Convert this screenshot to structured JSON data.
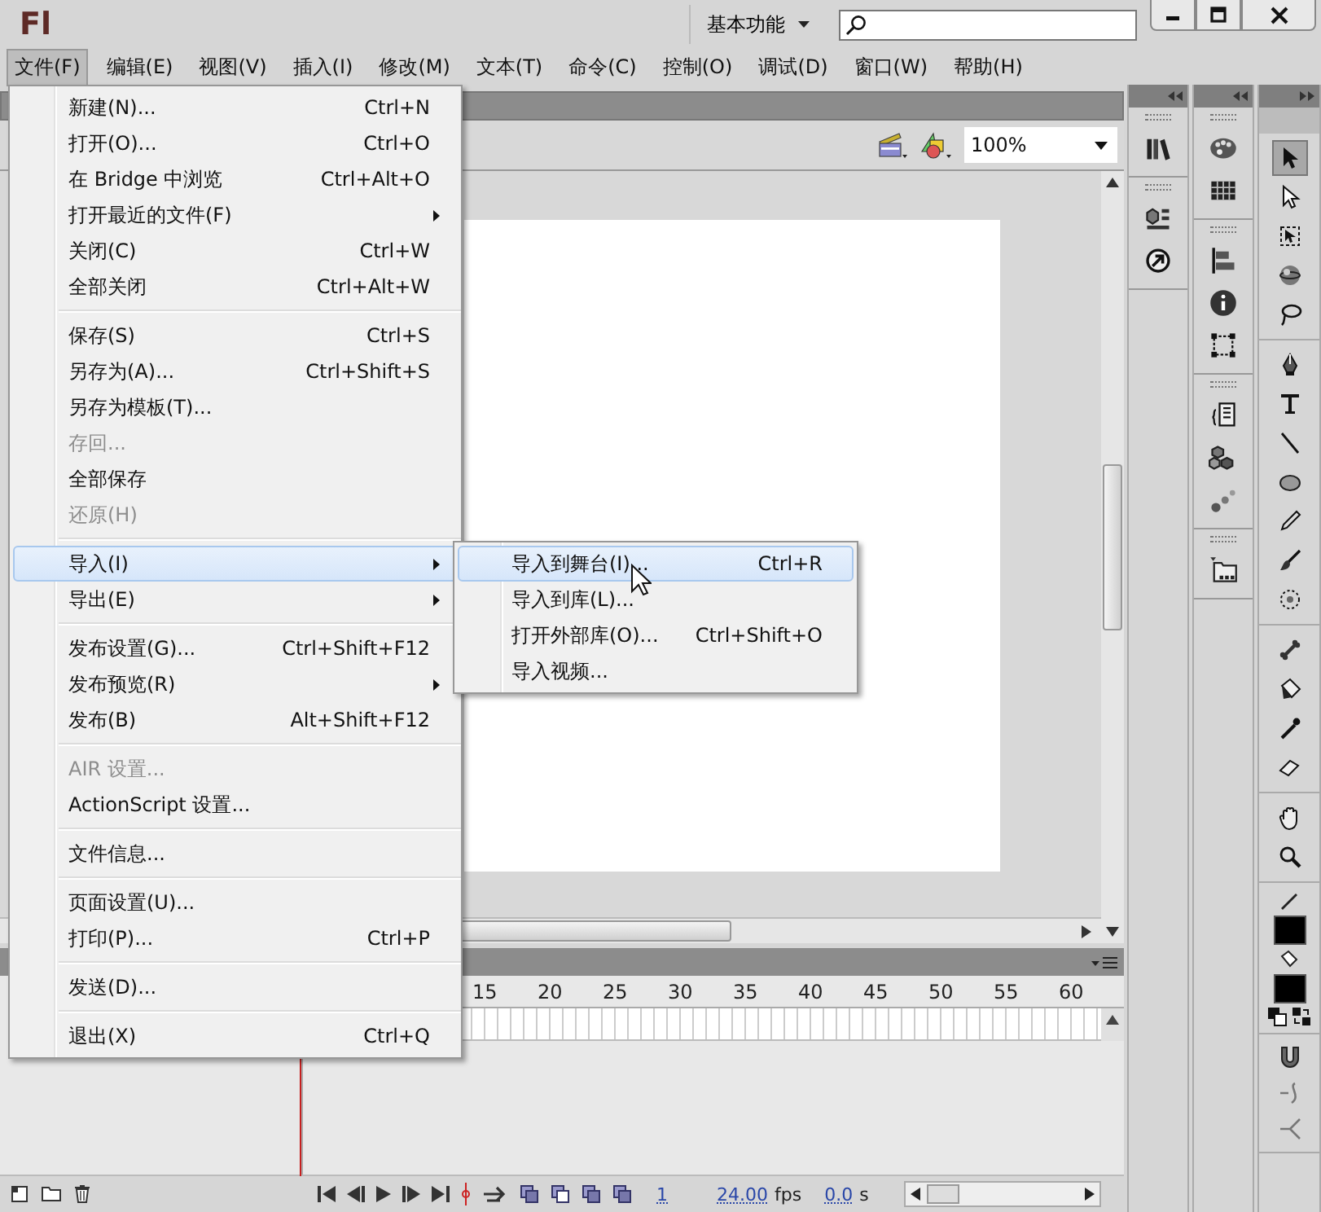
{
  "app_logo": "Fl",
  "workspace": {
    "label": "基本功能"
  },
  "menubar": [
    {
      "label": "文件(F)",
      "selected": true
    },
    {
      "label": "编辑(E)",
      "selected": false
    },
    {
      "label": "视图(V)",
      "selected": false
    },
    {
      "label": "插入(I)",
      "selected": false
    },
    {
      "label": "修改(M)",
      "selected": false
    },
    {
      "label": "文本(T)",
      "selected": false
    },
    {
      "label": "命令(C)",
      "selected": false
    },
    {
      "label": "控制(O)",
      "selected": false
    },
    {
      "label": "调试(D)",
      "selected": false
    },
    {
      "label": "窗口(W)",
      "selected": false
    },
    {
      "label": "帮助(H)",
      "selected": false
    }
  ],
  "file_menu": [
    [
      {
        "label": "新建(N)...",
        "shortcut": "Ctrl+N",
        "submenu": false,
        "disabled": false,
        "selected": false
      },
      {
        "label": "打开(O)...",
        "shortcut": "Ctrl+O",
        "submenu": false,
        "disabled": false,
        "selected": false
      },
      {
        "label": "在 Bridge 中浏览",
        "shortcut": "Ctrl+Alt+O",
        "submenu": false,
        "disabled": false,
        "selected": false
      },
      {
        "label": "打开最近的文件(F)",
        "submenu": true,
        "disabled": false,
        "selected": false
      },
      {
        "label": "关闭(C)",
        "shortcut": "Ctrl+W",
        "submenu": false,
        "disabled": false,
        "selected": false
      },
      {
        "label": "全部关闭",
        "shortcut": "Ctrl+Alt+W",
        "submenu": false,
        "disabled": false,
        "selected": false
      }
    ],
    [
      {
        "label": "保存(S)",
        "shortcut": "Ctrl+S",
        "submenu": false,
        "disabled": false,
        "selected": false
      },
      {
        "label": "另存为(A)...",
        "shortcut": "Ctrl+Shift+S",
        "submenu": false,
        "disabled": false,
        "selected": false
      },
      {
        "label": "另存为模板(T)...",
        "submenu": false,
        "disabled": false,
        "selected": false
      },
      {
        "label": "存回...",
        "submenu": false,
        "disabled": true,
        "selected": false
      },
      {
        "label": "全部保存",
        "submenu": false,
        "disabled": false,
        "selected": false
      },
      {
        "label": "还原(H)",
        "submenu": false,
        "disabled": true,
        "selected": false
      }
    ],
    [
      {
        "label": "导入(I)",
        "submenu": true,
        "disabled": false,
        "selected": true
      },
      {
        "label": "导出(E)",
        "submenu": true,
        "disabled": false,
        "selected": false
      }
    ],
    [
      {
        "label": "发布设置(G)...",
        "shortcut": "Ctrl+Shift+F12",
        "submenu": false,
        "disabled": false,
        "selected": false
      },
      {
        "label": "发布预览(R)",
        "submenu": true,
        "disabled": false,
        "selected": false
      },
      {
        "label": "发布(B)",
        "shortcut": "Alt+Shift+F12",
        "submenu": false,
        "disabled": false,
        "selected": false
      }
    ],
    [
      {
        "label": "AIR 设置...",
        "submenu": false,
        "disabled": true,
        "selected": false
      },
      {
        "label": "ActionScript 设置...",
        "submenu": false,
        "disabled": false,
        "selected": false
      }
    ],
    [
      {
        "label": "文件信息...",
        "submenu": false,
        "disabled": false,
        "selected": false
      }
    ],
    [
      {
        "label": "页面设置(U)...",
        "submenu": false,
        "disabled": false,
        "selected": false
      },
      {
        "label": "打印(P)...",
        "shortcut": "Ctrl+P",
        "submenu": false,
        "disabled": false,
        "selected": false
      }
    ],
    [
      {
        "label": "发送(D)...",
        "submenu": false,
        "disabled": false,
        "selected": false
      }
    ],
    [
      {
        "label": "退出(X)",
        "shortcut": "Ctrl+Q",
        "submenu": false,
        "disabled": false,
        "selected": false
      }
    ]
  ],
  "import_submenu": [
    {
      "label": "导入到舞台(I)...",
      "shortcut": "Ctrl+R",
      "selected": true
    },
    {
      "label": "导入到库(L)...",
      "selected": false
    },
    {
      "label": "打开外部库(O)...",
      "shortcut": "Ctrl+Shift+O",
      "selected": false
    },
    {
      "label": "导入视频...",
      "selected": false
    }
  ],
  "zoom": {
    "value": "100%"
  },
  "tools": [
    [
      {
        "kind": "selection",
        "selected": true
      },
      {
        "kind": "subselection",
        "selected": false
      },
      {
        "kind": "free-transform",
        "selected": false
      },
      {
        "kind": "rotate-3d",
        "selected": false
      },
      {
        "kind": "lasso",
        "selected": false
      }
    ],
    [
      {
        "kind": "pen",
        "selected": false
      },
      {
        "kind": "text",
        "selected": false
      },
      {
        "kind": "line",
        "selected": false
      },
      {
        "kind": "oval",
        "selected": false
      },
      {
        "kind": "pencil",
        "selected": false
      },
      {
        "kind": "brush",
        "selected": false
      },
      {
        "kind": "deco",
        "selected": false
      }
    ],
    [
      {
        "kind": "bone",
        "selected": false
      },
      {
        "kind": "bucket",
        "selected": false
      },
      {
        "kind": "eyedropper",
        "selected": false
      },
      {
        "kind": "eraser",
        "selected": false
      }
    ],
    [
      {
        "kind": "hand",
        "selected": false
      },
      {
        "kind": "zoom",
        "selected": false
      }
    ]
  ],
  "swatches": [
    {
      "kind": "stroke",
      "color": "#000000"
    },
    {
      "kind": "fill",
      "color": "#000000"
    }
  ],
  "timeline": {
    "ruler": [
      "15",
      "20",
      "25",
      "30",
      "35",
      "40",
      "45",
      "50",
      "55",
      "60"
    ],
    "frame": "1",
    "fps": "24.00",
    "fps_unit": "fps",
    "time": "0.0",
    "time_unit": "s"
  }
}
